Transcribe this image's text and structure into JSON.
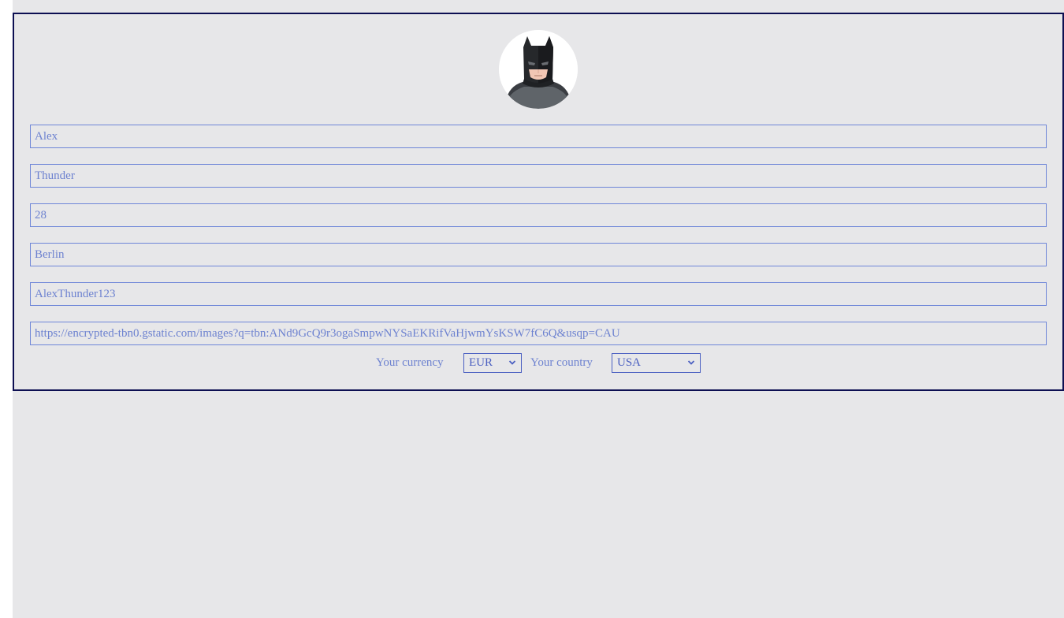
{
  "profile": {
    "avatar_icon": "batman-avatar-icon",
    "fields": [
      {
        "name": "first-name-field",
        "value": "Alex"
      },
      {
        "name": "last-name-field",
        "value": "Thunder"
      },
      {
        "name": "age-field",
        "value": "28"
      },
      {
        "name": "city-field",
        "value": "Berlin"
      },
      {
        "name": "username-field",
        "value": "AlexThunder123"
      },
      {
        "name": "avatar-url-field",
        "value": "https://encrypted-tbn0.gstatic.com/images?q=tbn:ANd9GcQ9r3ogaSmpwNYSaEKRifVaHjwmYsKSW7fC6Q&usqp=CAU"
      }
    ],
    "currency": {
      "label": "Your currency",
      "selected": "EUR"
    },
    "country": {
      "label": "Your country",
      "selected": "USA"
    }
  },
  "colors": {
    "background": "#e7e7e9",
    "card_border": "#0d0f52",
    "field_border": "#6e86d8",
    "text": "#6d82d0",
    "select_accent": "#4a5fc1"
  }
}
